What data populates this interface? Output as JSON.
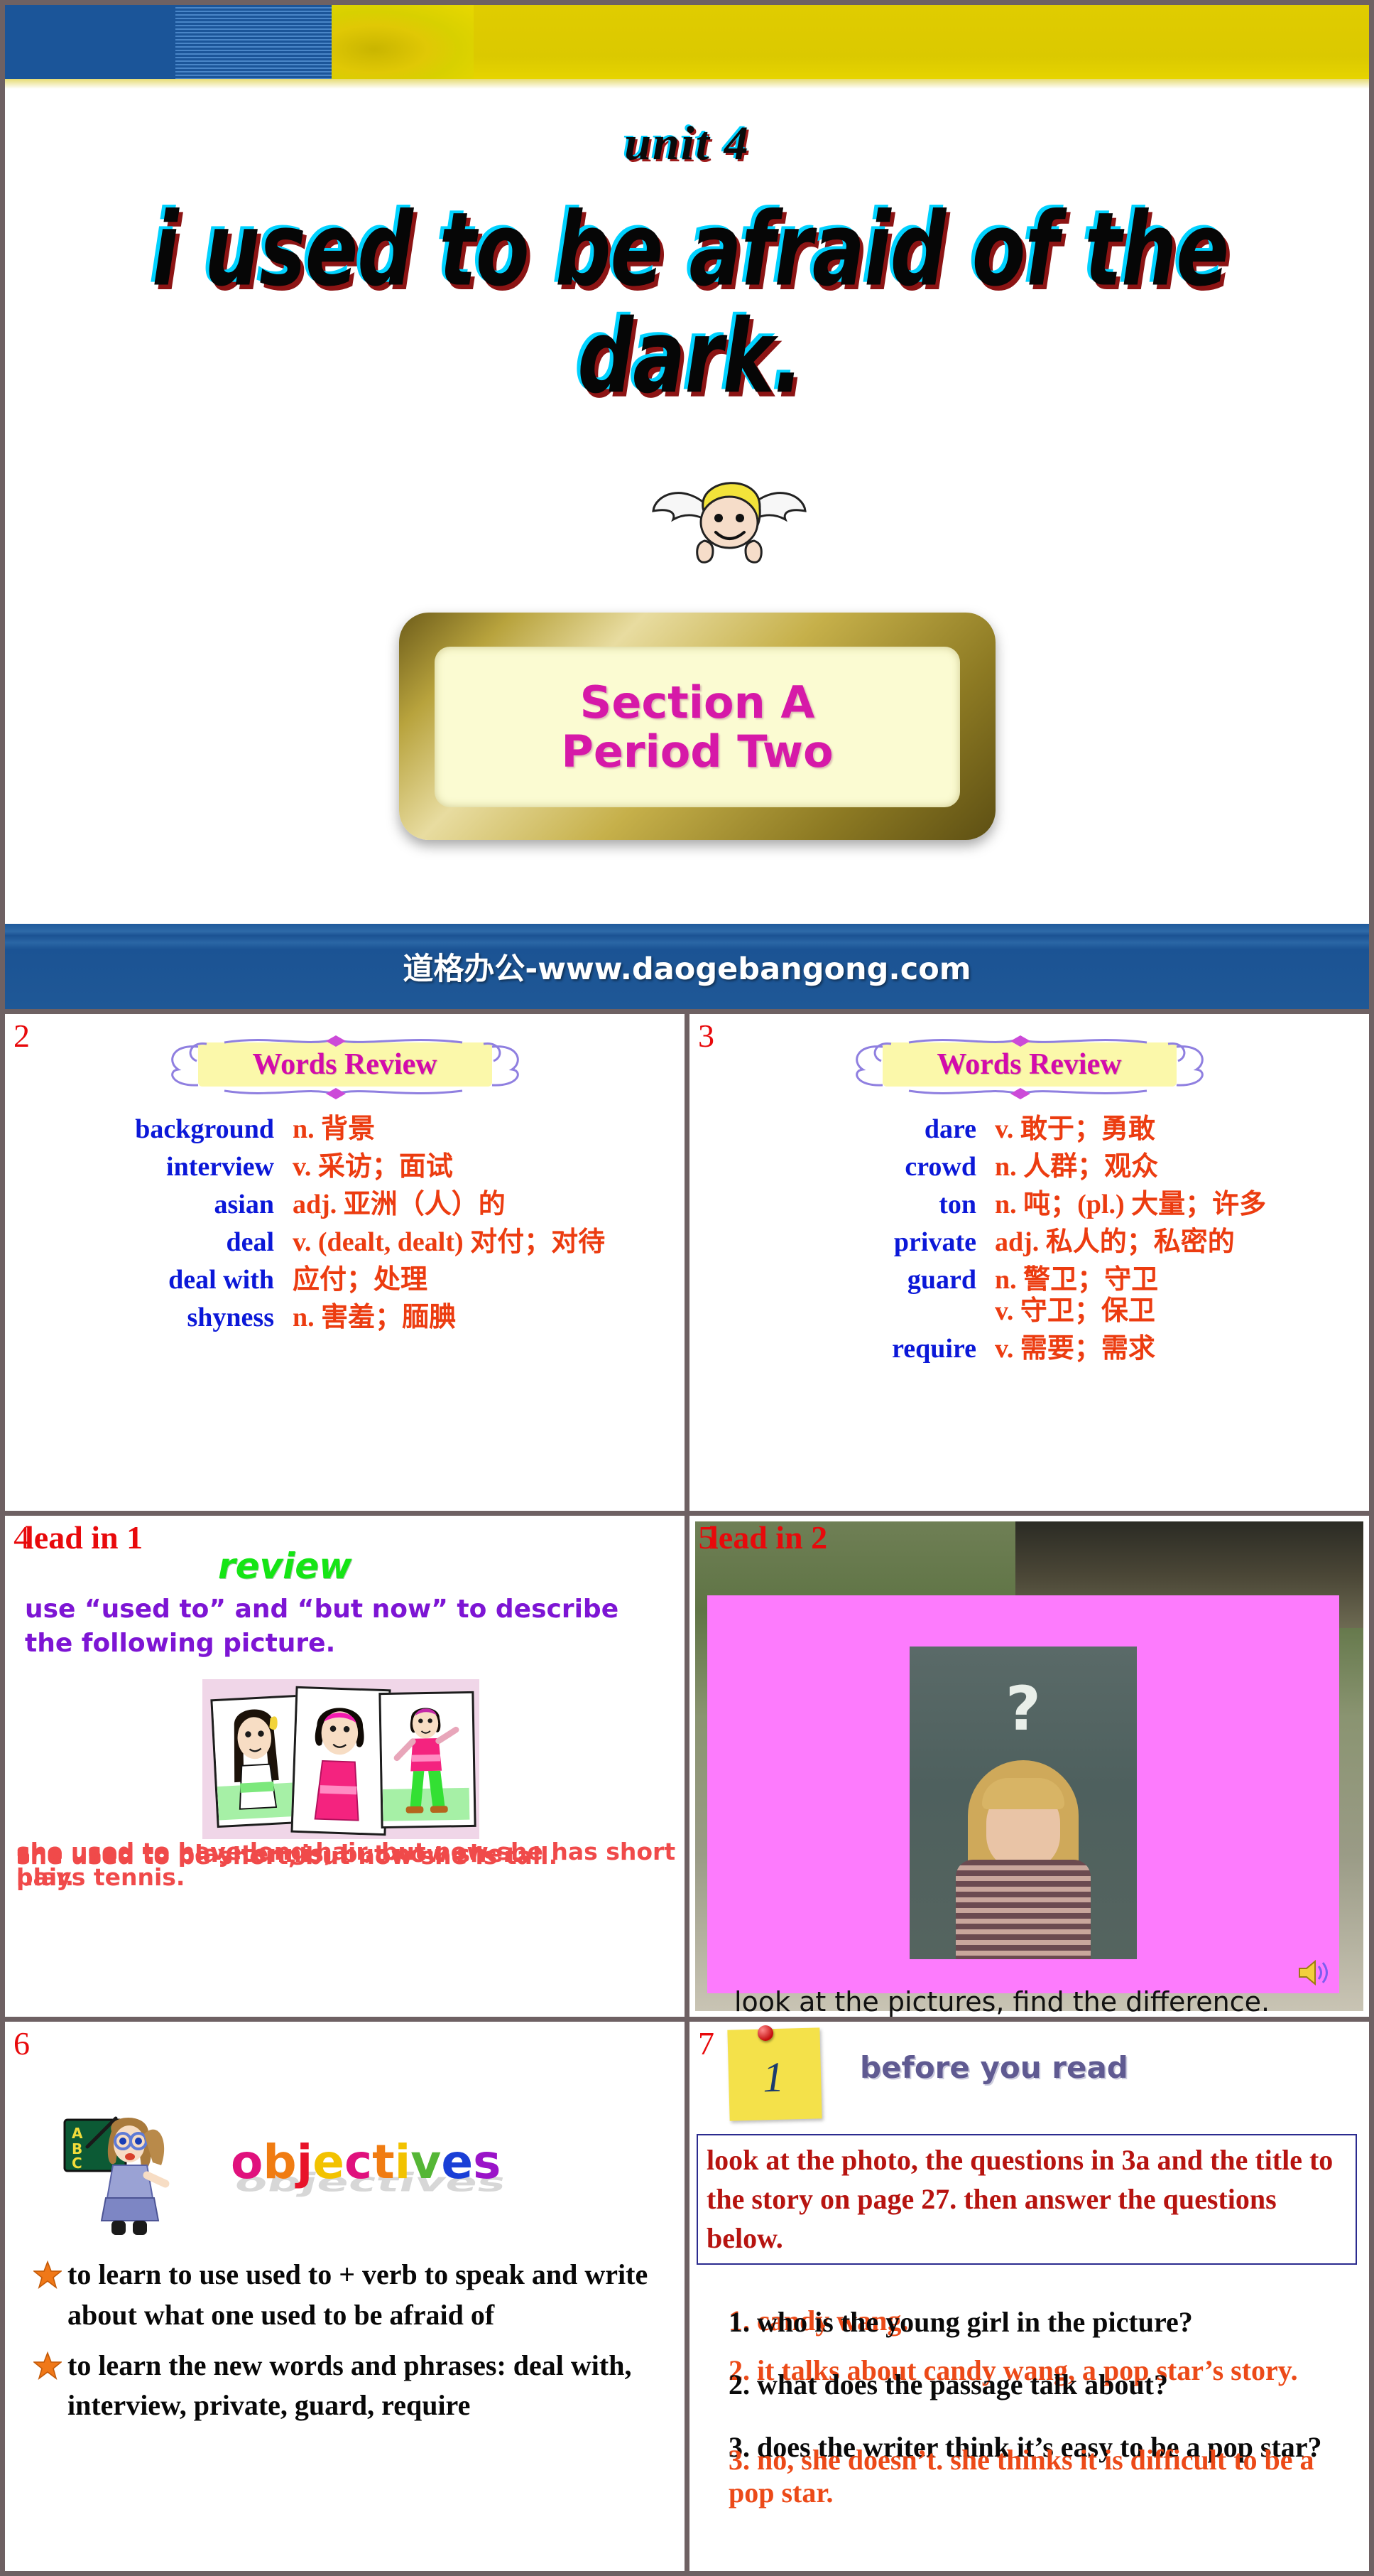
{
  "title_slide": {
    "unit": "unit 4",
    "main_title": "i used to be afraid of the dark.",
    "sign_line1": "Section A",
    "sign_line2": "Period Two",
    "watermark": "道格办公-www.daogebangong.com"
  },
  "panels": {
    "p2": {
      "number": "2",
      "heading": "Words Review",
      "words": [
        {
          "en": "background",
          "cn": "n. 背景"
        },
        {
          "en": "interview",
          "cn": "v. 采访；面试"
        },
        {
          "en": "asian",
          "cn": "adj. 亚洲（人）的"
        },
        {
          "en": "deal",
          "cn": "v. (dealt, dealt) 对付；对待"
        },
        {
          "en": "deal with",
          "cn": "应付；处理"
        },
        {
          "en": "shyness",
          "cn": "n. 害羞；腼腆"
        }
      ]
    },
    "p3": {
      "number": "3",
      "heading": "Words Review",
      "words": [
        {
          "en": "dare",
          "cn": "v. 敢于；勇敢"
        },
        {
          "en": "crowd",
          "cn": "n. 人群；观众"
        },
        {
          "en": "ton",
          "cn": "n. 吨；(pl.) 大量；许多"
        },
        {
          "en": "private",
          "cn": "adj. 私人的；私密的"
        },
        {
          "en": "guard",
          "cn": "n. 警卫；守卫\nv. 守卫；保卫"
        },
        {
          "en": "require",
          "cn": "v. 需要；需求"
        }
      ]
    },
    "p4": {
      "number": "4",
      "lead_label": "lead in 1",
      "review_word": "review",
      "instruction": "use “used to” and “but now” to describe the following picture.",
      "sentences": [
        "she used to have long hair, but now she has short hair.",
        "she used to play tennis, but now she...",
        "she used to be short, but now she is tall.",
        "plays tennis."
      ]
    },
    "p5": {
      "number": "5",
      "lead_label": "lead in 2",
      "question_mark": "?",
      "text": "look at the pictures, find the difference. and try to describe them !",
      "speaker_icon": "speaker-icon"
    },
    "p6": {
      "number": "6",
      "objectives_word": "objectives",
      "objectives_letters": [
        {
          "ch": "o",
          "color": "#e0117d"
        },
        {
          "ch": "b",
          "color": "#f07c12"
        },
        {
          "ch": "j",
          "color": "#e8132a"
        },
        {
          "ch": "e",
          "color": "#f2c200"
        },
        {
          "ch": "c",
          "color": "#e0117d"
        },
        {
          "ch": "t",
          "color": "#f07c12"
        },
        {
          "ch": "i",
          "color": "#f2c200"
        },
        {
          "ch": "v",
          "color": "#55b636"
        },
        {
          "ch": "e",
          "color": "#1a3fd6"
        },
        {
          "ch": "s",
          "color": "#9a14c8"
        }
      ],
      "items": [
        "to learn to use used to + verb to speak and write about what one used to be afraid of",
        "to learn the new words and phrases: deal with, interview, private, guard, require"
      ]
    },
    "p7": {
      "number": "7",
      "note_number": "1",
      "heading": "before you read",
      "box_text": "look at the photo, the questions in 3a and the title to the story on page 27. then answer the questions below.",
      "questions": [
        "1. who is the young girl in the picture?",
        "2. what does the passage talk about?",
        "3. does the writer think it’s easy to be a pop star?"
      ],
      "answers": [
        "1. candy wang.",
        "2. it talks about candy wang, a pop star’s story.",
        "3. no, she doesn’t. she thinks it is difficult to be a pop star."
      ]
    }
  },
  "colors": {
    "banner_blue": "#1b5599",
    "banner_yellow": "#e0cc00",
    "watermark_blue": "#1f5896",
    "panel_border": "#6e6163",
    "number_red": "#e8090b",
    "word_blue": "#0b18d8",
    "word_orange": "#ec3c10",
    "heading_magenta": "#d30bab",
    "pink_slide": "#fd7bfd"
  }
}
